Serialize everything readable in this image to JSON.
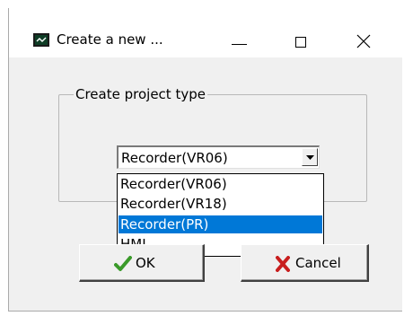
{
  "window": {
    "title": "Create a new ..."
  },
  "group": {
    "label": "Create project type"
  },
  "combo": {
    "selected_value": "Recorder(VR06)",
    "options": [
      {
        "label": "Recorder(VR06)",
        "highlighted": false
      },
      {
        "label": "Recorder(VR18)",
        "highlighted": false
      },
      {
        "label": "Recorder(PR)",
        "highlighted": true
      },
      {
        "label": "HMI",
        "highlighted": false
      }
    ]
  },
  "buttons": {
    "ok_label": "OK",
    "cancel_label": "Cancel"
  },
  "colors": {
    "highlight": "#0078d7",
    "dialog_bg": "#f0f0f0",
    "ok_check": "#3a9a2a",
    "cancel_x": "#c81e1e"
  },
  "icons": {
    "app": "monitor-chart-icon",
    "minimize": "minimize-icon",
    "maximize": "maximize-icon",
    "close": "close-icon",
    "dropdown": "chevron-down-icon",
    "ok": "checkmark-icon",
    "cancel": "x-mark-icon"
  }
}
